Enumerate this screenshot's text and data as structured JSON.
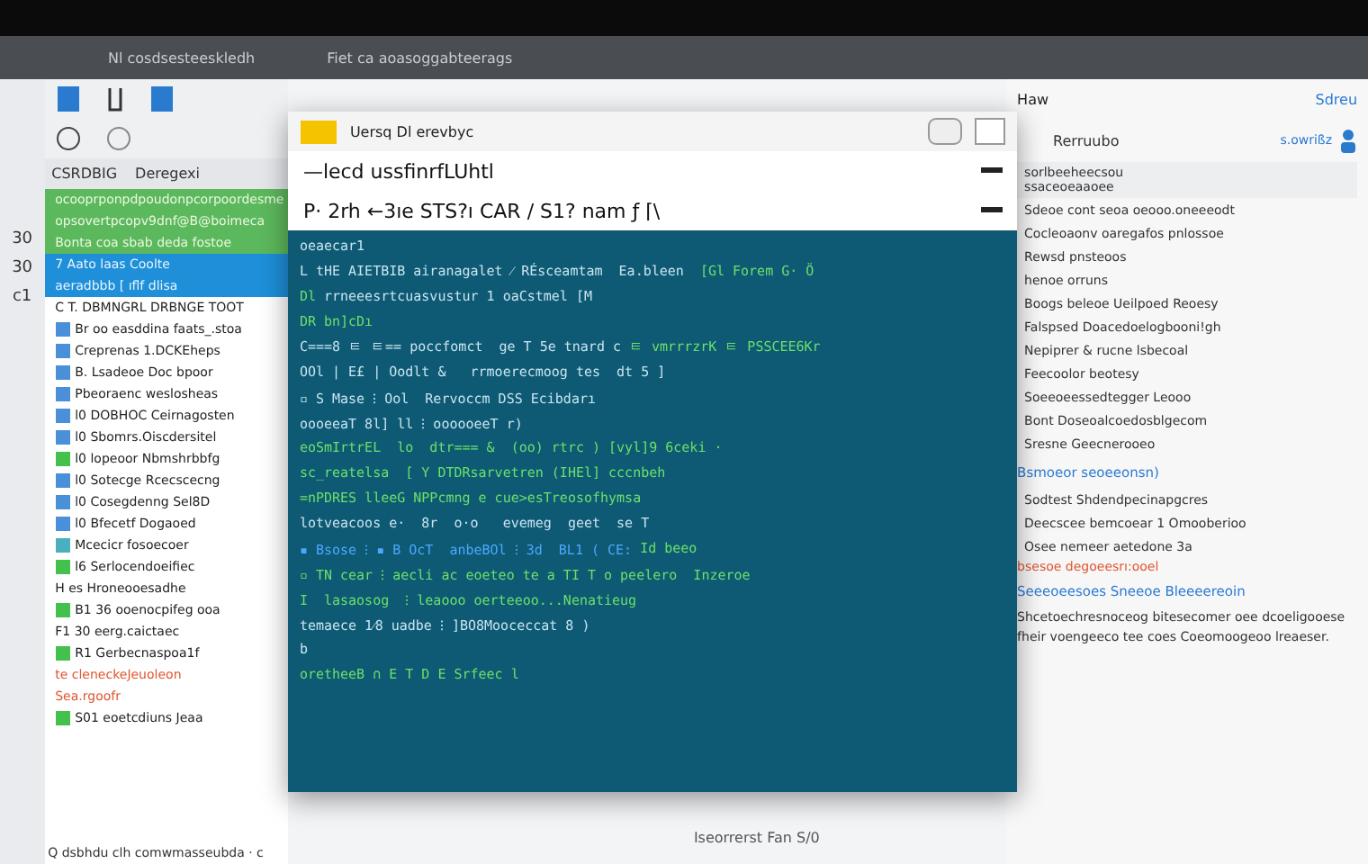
{
  "title_bar": {
    "items": [
      "Nl cosdsesteeskledh",
      "Fiet ca aoasoggabteerags"
    ]
  },
  "toolbar": {
    "tab": "Haw",
    "link": "Sdreu",
    "account": "s.owrißz"
  },
  "gutter": [
    "30",
    "30",
    "c1"
  ],
  "left_panel": {
    "headers": [
      "CSRDBIG",
      "Deregexi"
    ],
    "rows": [
      {
        "kind": "green",
        "text": "ocooprponpdpoudonpcorpoordesme"
      },
      {
        "kind": "green",
        "text": "opsovertpcopv9dnf@B@boimeca"
      },
      {
        "kind": "green",
        "text": "Bonta coa sbab deda fostoe"
      },
      {
        "kind": "blue",
        "text": "7 Aato laas Coolte"
      },
      {
        "kind": "blue",
        "text": "aeradbbb [ ıflf dlisa"
      },
      {
        "kind": "plain",
        "text": "C T. DBMNGRL DRBNGE TOOT"
      },
      {
        "kind": "plain",
        "text": "Br oo easddina faats_.stoa",
        "color": "#4a90d9"
      },
      {
        "kind": "plain",
        "text": "Creprenas 1.DCKEheps",
        "color": "#4a90d9"
      },
      {
        "kind": "plain",
        "text": "B. Lsadeoe Doc bpoor",
        "color": "#4a90d9"
      },
      {
        "kind": "plain",
        "text": "Pbeoraenc weslosheas",
        "color": "#4a90d9"
      },
      {
        "kind": "plain",
        "text": "l0 DOBHOC Ceirnagosten",
        "color": "#4a90d9"
      },
      {
        "kind": "plain",
        "text": "l0 Sbomrs.Oiscdersitel",
        "color": "#4a90d9"
      },
      {
        "kind": "plain",
        "text": "l0 lopeoor Nbmshrbbfg",
        "color": "#44c04c"
      },
      {
        "kind": "plain",
        "text": "l0 Sotecge Rcecscecng",
        "color": "#4a90d9"
      },
      {
        "kind": "plain",
        "text": "l0 Cosegdenng Sel8D",
        "color": "#4a90d9"
      },
      {
        "kind": "plain",
        "text": "l0 Bfecetf Dogaoed",
        "color": "#4a90d9"
      },
      {
        "kind": "plain",
        "text": "Mcecicr fosoecoer",
        "color": "#4ab0c0"
      },
      {
        "kind": "plain",
        "text": "l6 Serlocendoeifiec",
        "color": "#44c04c"
      },
      {
        "kind": "plain",
        "text": "H es Hroneooesadhe"
      },
      {
        "kind": "plain",
        "text": "B1 36 ooenocpifeg ooa",
        "color": "#44c04c"
      },
      {
        "kind": "plain",
        "text": "F1 30 eerg.caictaec"
      },
      {
        "kind": "plain",
        "text": "R1 Gerbecnaspoa1f",
        "color": "#44c04c"
      },
      {
        "kind": "alert",
        "text": "te cleneckeJeuoleon"
      },
      {
        "kind": "alert",
        "text": "Sea.rgoofr"
      },
      {
        "kind": "plain",
        "text": "S01 eoetcdiuns Jeaa",
        "color": "#44c04c"
      }
    ]
  },
  "terminal": {
    "title": "Uersq Dl erevbyc",
    "lines": [
      "—lecd ussfinrfLUhtl",
      "P· 2rh ←3ıe STS?ı CAR / S1? nam ƒ ⌈\\"
    ],
    "body": [
      [
        {
          "kind": "plain",
          "text": "oeaecar1"
        }
      ],
      [
        {
          "kind": "plain",
          "text": "L tHE AIETBIB airanagalet ⁄ RÉsceamtam  Ea.bleen"
        },
        {
          "kind": "green",
          "text": "  [Gl Forem G· Ö"
        }
      ],
      [
        {
          "kind": "green",
          "text": "Dl"
        },
        {
          "kind": "plain",
          "text": " rrneeesrtcuasvustur 1 oaCstmel [M"
        }
      ],
      [
        {
          "kind": "green",
          "text": "DR bn]cDı"
        }
      ],
      [
        {
          "kind": "plain",
          "text": "C===8 ㅌ ㅌ== poccfomct  ge T 5e tnard c"
        },
        {
          "kind": "green",
          "text": " ㅌ vmrrrzrK ㅌ PSSCEE6Kr"
        }
      ],
      [
        {
          "kind": "plain",
          "text": "OOl | E£ | Oodlt &   rrmoerecmoog tes  dt 5 ]"
        }
      ],
      [
        {
          "kind": "plain",
          "text": "▫ S Mase ⁝ Ool  Rervoccm DSS Ecibdarı"
        }
      ],
      [
        {
          "kind": "plain",
          "text": "oooeeaT 8l] ll ⁝ oooooeeT r)"
        }
      ],
      [
        {
          "kind": "green",
          "text": "eoSmIrtrEL  lo  dtr=== &  (oo) rtrc ) [vyl]9 6ceki ·"
        }
      ],
      [
        {
          "kind": "green",
          "text": "sc_reatelsa  [ Y DTDRsarvetren (IHEl] cccnbeh"
        }
      ],
      [
        {
          "kind": "green",
          "text": "=nPDRES lleeG NPPcmng e cue>esTreosofhymsa"
        }
      ],
      [
        {
          "kind": "plain",
          "text": "lotveacoos e·  8r  o·o   evemeg  geet  se T"
        }
      ],
      [
        {
          "kind": "blue",
          "text": "▪ Bsose ⁝ ▪ B OcT  anbeBOl ⁝ 3d  BL1 ( CE:"
        },
        {
          "kind": "green",
          "text": " Id beeo"
        }
      ],
      [
        {
          "kind": "green",
          "text": "▫ TN cear ⁝ aecli ac eoeteo te a TI T o peelero  Inzeroe"
        }
      ],
      [
        {
          "kind": "green",
          "text": "I  lasaosog  ⁝ leaooo oerteeoo...Nenatieug"
        }
      ],
      [
        {
          "kind": "plain",
          "text": "temaece 1⁄8 uadbe ⁝ ]BO8Mooceccat 8 )"
        }
      ],
      [
        {
          "kind": "plain",
          "text": "b"
        }
      ],
      [
        {
          "kind": "green",
          "text": "oretheeB ∩ E T D E Srfeec l"
        }
      ]
    ]
  },
  "right_panel": {
    "header": "Rerruubo",
    "sub": [
      "sorlbeeheecsou",
      "ssaceoeaaoee"
    ],
    "items": [
      "Sdeoe cont seoa oeooo.oneeeodt",
      "Cocleoaonv oaregafos pnlossoe",
      "Rewsd pnsteoos",
      "henoe orruns",
      "Boogs beleoe Ueilpoed Reoesy",
      "Falspsed Doacedoelogbooni!gh",
      "Nepiprer & rucne lsbecoal",
      "Feecoolor beotesy",
      "Soeeoeessedtegger Leooo",
      "Bont Doseoalcoedosblgecom",
      "Sresne Geecnerooeo"
    ],
    "section": "Bsmoeor seoeeonsn)",
    "items2": [
      "Sodtest Shdendpecinapgcres",
      "Deecscee bemcoear 1 Omooberioo",
      "Osee nemeer aetedone 3a"
    ],
    "alert": "bsesoe degoeesrı:ooel",
    "link": "Seeeoeesoes Sneeoe Bleeeereoin",
    "paragraph": "Shcetoechresnoceog bitesecomer oee dcoeligooese fheir voengeeco tee coes Coeomoogeoo lreaeser."
  },
  "status": {
    "bottom_left": "Q dsbhdu clh comwmasseubda · c",
    "bottom_center": "Iseorrerst Fan S/0"
  }
}
